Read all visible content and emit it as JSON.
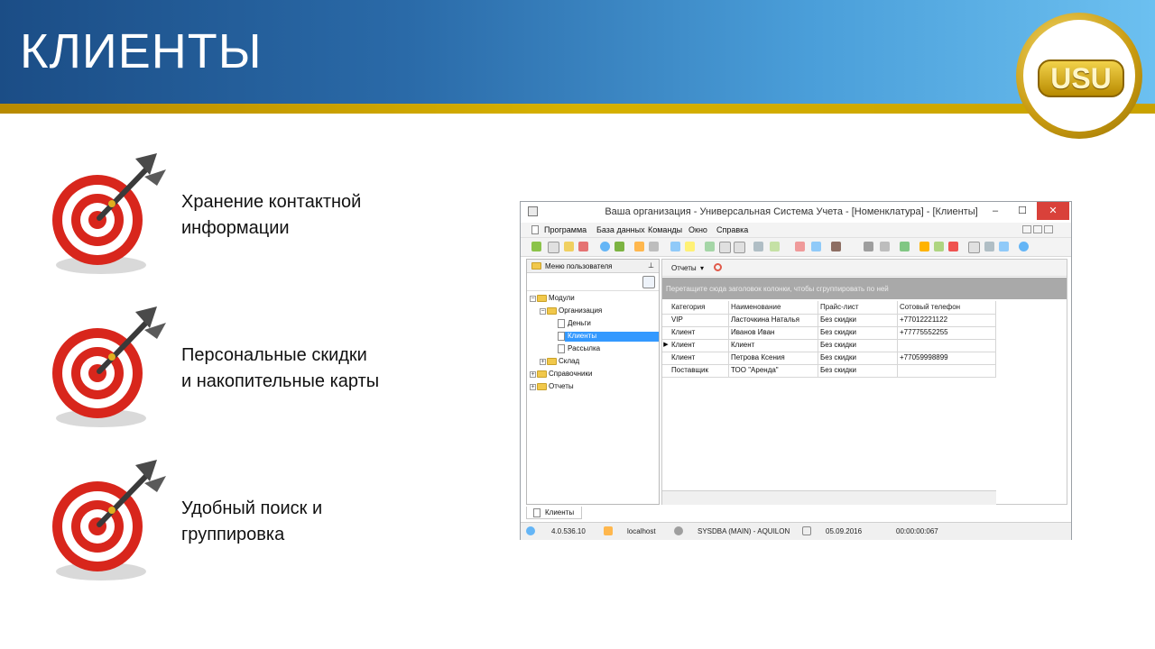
{
  "slide": {
    "title": "КЛИЕНТЫ",
    "logo_text": "USU",
    "features": [
      {
        "text": "Хранение контактной\nинформации",
        "icon": "target-dart-icon"
      },
      {
        "text": "Персональные скидки\nи накопительные карты",
        "icon": "target-dart-icon"
      },
      {
        "text": "Удобный поиск и\nгруппировка",
        "icon": "target-dart-icon"
      }
    ]
  },
  "window": {
    "title": "Ваша организация - Универсальная Система Учета - [Номенклатура] - [Клиенты]",
    "controls": {
      "minimize": "–",
      "maximize": "☐",
      "close": "✕"
    },
    "menu": [
      "Программа",
      "База данных",
      "Команды",
      "Окно",
      "Справка"
    ],
    "left_panel": {
      "header": "Меню пользователя",
      "pin": "⊥",
      "tree": [
        {
          "label": "Модули",
          "expander": "−"
        },
        {
          "label": "Организация",
          "expander": "−"
        },
        {
          "label": "Деньги"
        },
        {
          "label": "Клиенты",
          "selected": true
        },
        {
          "label": "Рассылка"
        },
        {
          "label": "Склад",
          "expander": "+"
        },
        {
          "label": "Справочники",
          "expander": "+"
        },
        {
          "label": "Отчеты",
          "expander": "+"
        }
      ]
    },
    "right_panel": {
      "reports_label": "Отчеты",
      "reports_arrow": "▾",
      "group_hint": "Перетащите сюда заголовок колонки, чтобы сгруппировать по ней",
      "columns": [
        "Категория",
        "Наименование",
        "Прайс-лист",
        "Сотовый телефон"
      ],
      "rows": [
        [
          "VIP",
          "Ласточкина Наталья",
          "Без скидки",
          "+77012221122"
        ],
        [
          "Клиент",
          "Иванов Иван",
          "Без скидки",
          "+77775552255"
        ],
        [
          "Клиент",
          "Клиент",
          "Без скидки",
          ""
        ],
        [
          "Клиент",
          "Петрова Ксения",
          "Без скидки",
          "+77059998899"
        ],
        [
          "Поставщик",
          "ТОО \"Аренда\"",
          "Без скидки",
          ""
        ]
      ],
      "current_row_marker": "▶"
    },
    "doc_tab": "Клиенты",
    "status": {
      "version": "4.0.536.10",
      "server": "localhost",
      "user": "SYSDBA (MAIN) - AQUILON",
      "date": "05.09.2016",
      "time": "00:00:00:067"
    }
  },
  "colors": {
    "banner_dark": "#1b4d86",
    "banner_light": "#6cc0f0",
    "gold_line": "#d6b100",
    "target_red": "#d8261c",
    "selection_blue": "#3399ff",
    "close_red": "#d9413a"
  }
}
